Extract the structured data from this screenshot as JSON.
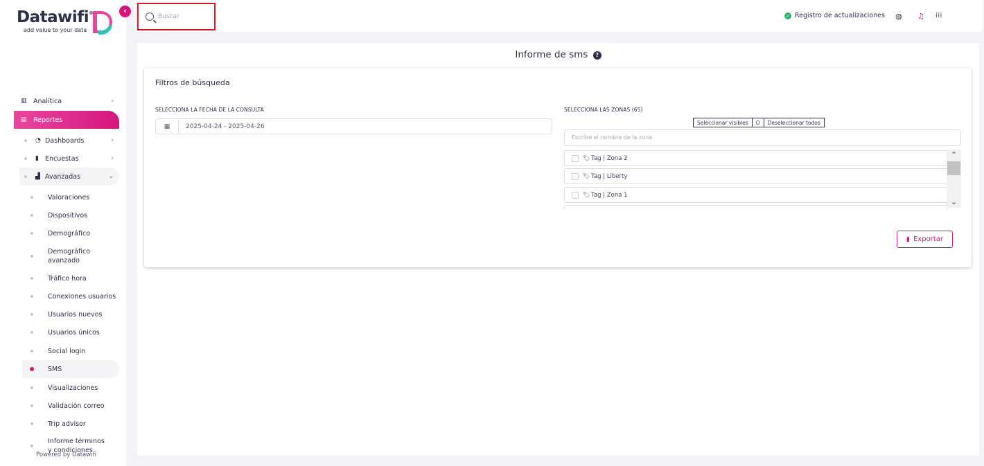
{
  "brand": {
    "name": "Datawifi",
    "registered": "®",
    "tagline": "add value to your data",
    "accent": "#d6157c",
    "mark_color": "#2ec4b6"
  },
  "sidebar": {
    "collapse_icon": "chevron-left-icon",
    "items": [
      {
        "label": "Analítica",
        "icon": "bar-chart-icon"
      },
      {
        "label": "Reportes",
        "icon": "document-icon"
      }
    ],
    "groups": [
      {
        "label": "Dashboards",
        "icon": "dashboard-icon"
      },
      {
        "label": "Encuestas",
        "icon": "clipboard-icon"
      },
      {
        "label": "Avanzadas",
        "icon": "bar-chart-icon"
      }
    ],
    "leaves": [
      "Valoraciones",
      "Dispositivos",
      "Demográfico",
      "Demográfico avanzado",
      "Tráfico hora",
      "Conexiones usuarios",
      "Usuarios nuevos",
      "Usuarios únicos",
      "Social login",
      "SMS",
      "Visualizaciones",
      "Validación correo",
      "Trip advisor",
      "Informe términos y condiciones"
    ],
    "selected": "SMS",
    "footer": "Powered by Datawifi"
  },
  "topbar": {
    "search_placeholder": "Buscar",
    "update_label": "Registro de actualizaciones",
    "icons": [
      "globe-icon",
      "bell-icon",
      "apps-grid-icon"
    ]
  },
  "page": {
    "title": "Informe de sms"
  },
  "filters": {
    "title": "Filtros de búsqueda",
    "date_label": "SELECCIONA LA FECHA DE LA CONSULTA",
    "date_value": "2025-04-24 - 2025-04-26",
    "zones_label": "SELECCIONA LAS ZONAS (65)",
    "select_visible": "Seleccionar visibles",
    "separator": "O",
    "deselect_all": "Deseleccionar todos",
    "zone_search_placeholder": "Escribe el nombre de la zona",
    "zones": [
      "Tag | Zona 2",
      "Tag | Liberty",
      "Tag | Zona 1"
    ],
    "export_label": "Exportar"
  }
}
